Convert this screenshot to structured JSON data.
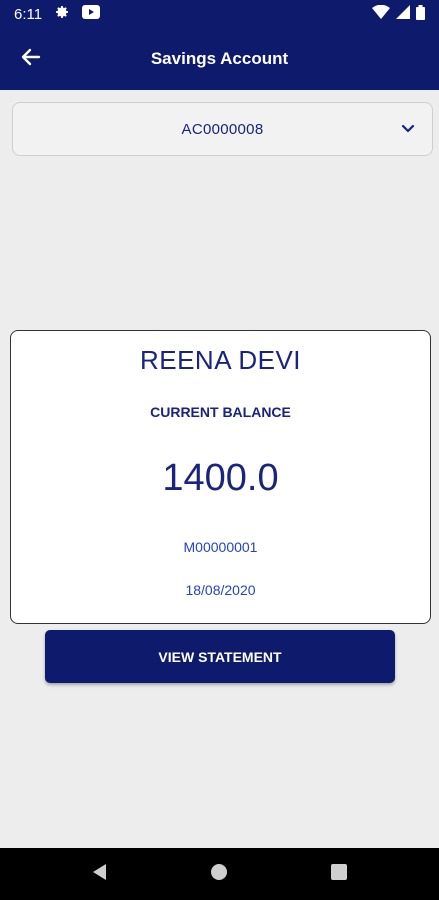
{
  "status_bar": {
    "time": "6:11",
    "icons": [
      "gear-icon",
      "youtube-icon",
      "wifi-icon",
      "signal-icon",
      "battery-icon"
    ]
  },
  "app_bar": {
    "title": "Savings Account",
    "back_icon": "arrow-left-icon"
  },
  "account_selector": {
    "selected_value": "AC0000008",
    "icon": "chevron-down-icon"
  },
  "balance_card": {
    "customer_name": "REENA DEVI",
    "balance_label": "CURRENT BALANCE",
    "balance_amount": "1400.0",
    "member_id": "M00000001",
    "date": "18/08/2020"
  },
  "actions": {
    "view_statement_label": "VIEW STATEMENT"
  },
  "nav_bar": {
    "buttons": [
      "back-triangle-icon",
      "home-circle-icon",
      "recents-square-icon"
    ]
  },
  "colors": {
    "primary": "#0e1a6b",
    "text_primary": "#1a237e",
    "text_link": "#2443c9",
    "background": "#ededed"
  }
}
